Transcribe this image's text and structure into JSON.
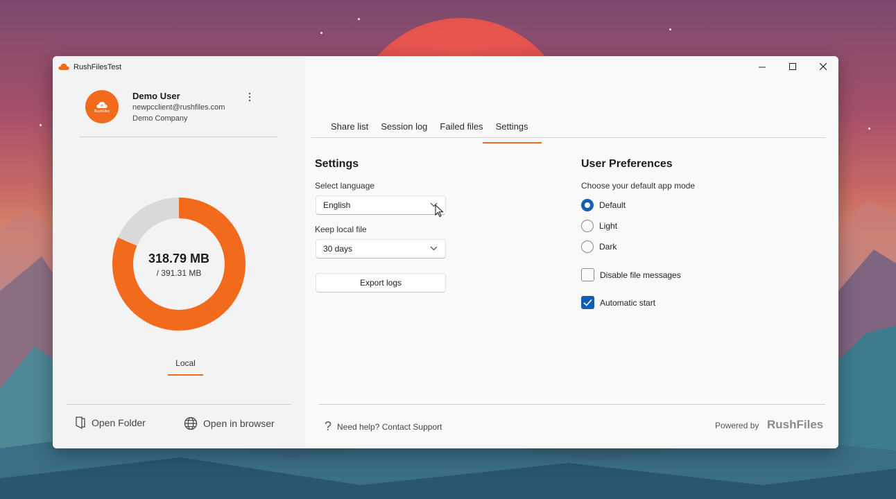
{
  "window": {
    "title": "RushFilesTest"
  },
  "user": {
    "avatar_text": "RushFiles",
    "name": "Demo User",
    "email": "newpcclient@rushfiles.com",
    "company": "Demo Company"
  },
  "storage": {
    "used": "318.79 MB",
    "total": "/ 391.31 MB",
    "used_fraction": 0.815,
    "tab_label": "Local"
  },
  "footer_left": {
    "open_folder": "Open Folder",
    "open_browser": "Open in browser"
  },
  "tabs": [
    {
      "label": "Share list"
    },
    {
      "label": "Session log"
    },
    {
      "label": "Failed files"
    },
    {
      "label": "Settings",
      "active": true
    }
  ],
  "settings": {
    "title": "Settings",
    "language_label": "Select language",
    "language_value": "English",
    "keep_label": "Keep local file",
    "keep_value": "30 days",
    "export_label": "Export logs"
  },
  "preferences": {
    "title": "User Preferences",
    "mode_label": "Choose your default app mode",
    "modes": [
      {
        "label": "Default",
        "selected": true
      },
      {
        "label": "Light",
        "selected": false
      },
      {
        "label": "Dark",
        "selected": false
      }
    ],
    "disable_messages": "Disable file messages",
    "disable_messages_checked": false,
    "automatic_start": "Automatic start",
    "automatic_start_checked": true
  },
  "footer_right": {
    "help": "Need help? Contact Support",
    "powered_by": "Powered by",
    "brand": "RushFiles"
  },
  "colors": {
    "accent": "#f26b1d",
    "selection": "#0f5fb3",
    "donut_remaining": "#d9d9d9"
  }
}
